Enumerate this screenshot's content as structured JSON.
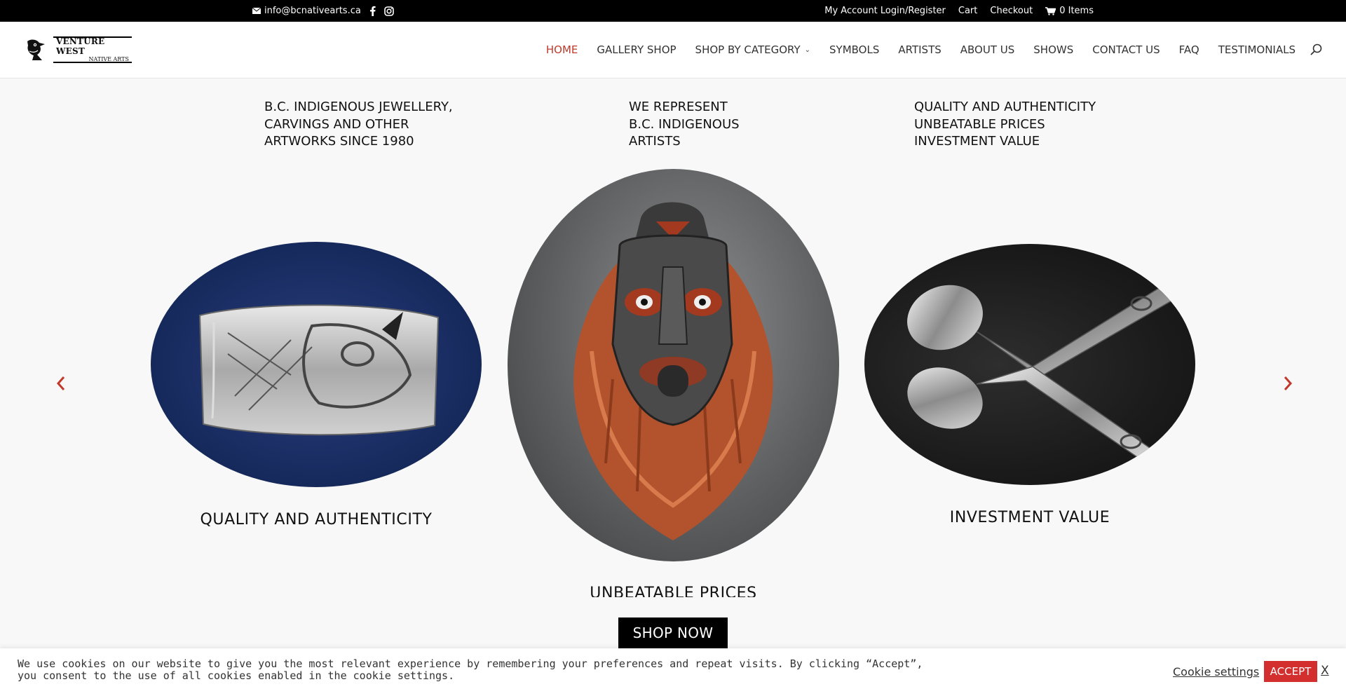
{
  "topbar": {
    "email": "info@bcnativearts.ca",
    "account": "My Account Login/Register",
    "cart": "Cart",
    "checkout": "Checkout",
    "cart_items": "0 Items"
  },
  "logo": {
    "line1": "VENTURE WEST",
    "line2": "NATIVE ARTS"
  },
  "nav": {
    "items": [
      {
        "label": "HOME",
        "active": true
      },
      {
        "label": "GALLERY SHOP"
      },
      {
        "label": "SHOP BY CATEGORY",
        "has_submenu": true
      },
      {
        "label": "SYMBOLS"
      },
      {
        "label": "ARTISTS"
      },
      {
        "label": "ABOUT US"
      },
      {
        "label": "SHOWS"
      },
      {
        "label": "CONTACT US"
      },
      {
        "label": "FAQ"
      },
      {
        "label": "TESTIMONIALS"
      }
    ]
  },
  "hero": {
    "taglines": [
      "B.C. INDIGENOUS JEWELLERY,\nCARVINGS AND OTHER\nARTWORKS SINCE 1980",
      "WE REPRESENT\nB.C. INDIGENOUS\nARTISTS",
      "QUALITY AND AUTHENTICITY\nUNBEATABLE PRICES\nINVESTMENT VALUE"
    ]
  },
  "carousel": {
    "slides": [
      {
        "caption": "QUALITY AND AUTHENTICITY",
        "image": "silver-bracelet"
      },
      {
        "caption": "UNBEATABLE PRICES",
        "image": "carved-mask"
      },
      {
        "caption": "INVESTMENT VALUE",
        "image": "silver-spoons"
      }
    ],
    "prev_icon": "chevron-left-icon",
    "next_icon": "chevron-right-icon"
  },
  "cta": {
    "shop_now": "SHOP NOW"
  },
  "cookie": {
    "text": "We use cookies on our website to give you the most relevant experience by remembering your preferences and repeat visits. By clicking “Accept”, you consent to the use of all cookies enabled in the cookie settings.",
    "settings": "Cookie settings",
    "accept": "ACCEPT",
    "close": "X"
  },
  "colors": {
    "accent": "#c0392b",
    "accept_button": "#d32f2f",
    "topbar": "#000000"
  }
}
